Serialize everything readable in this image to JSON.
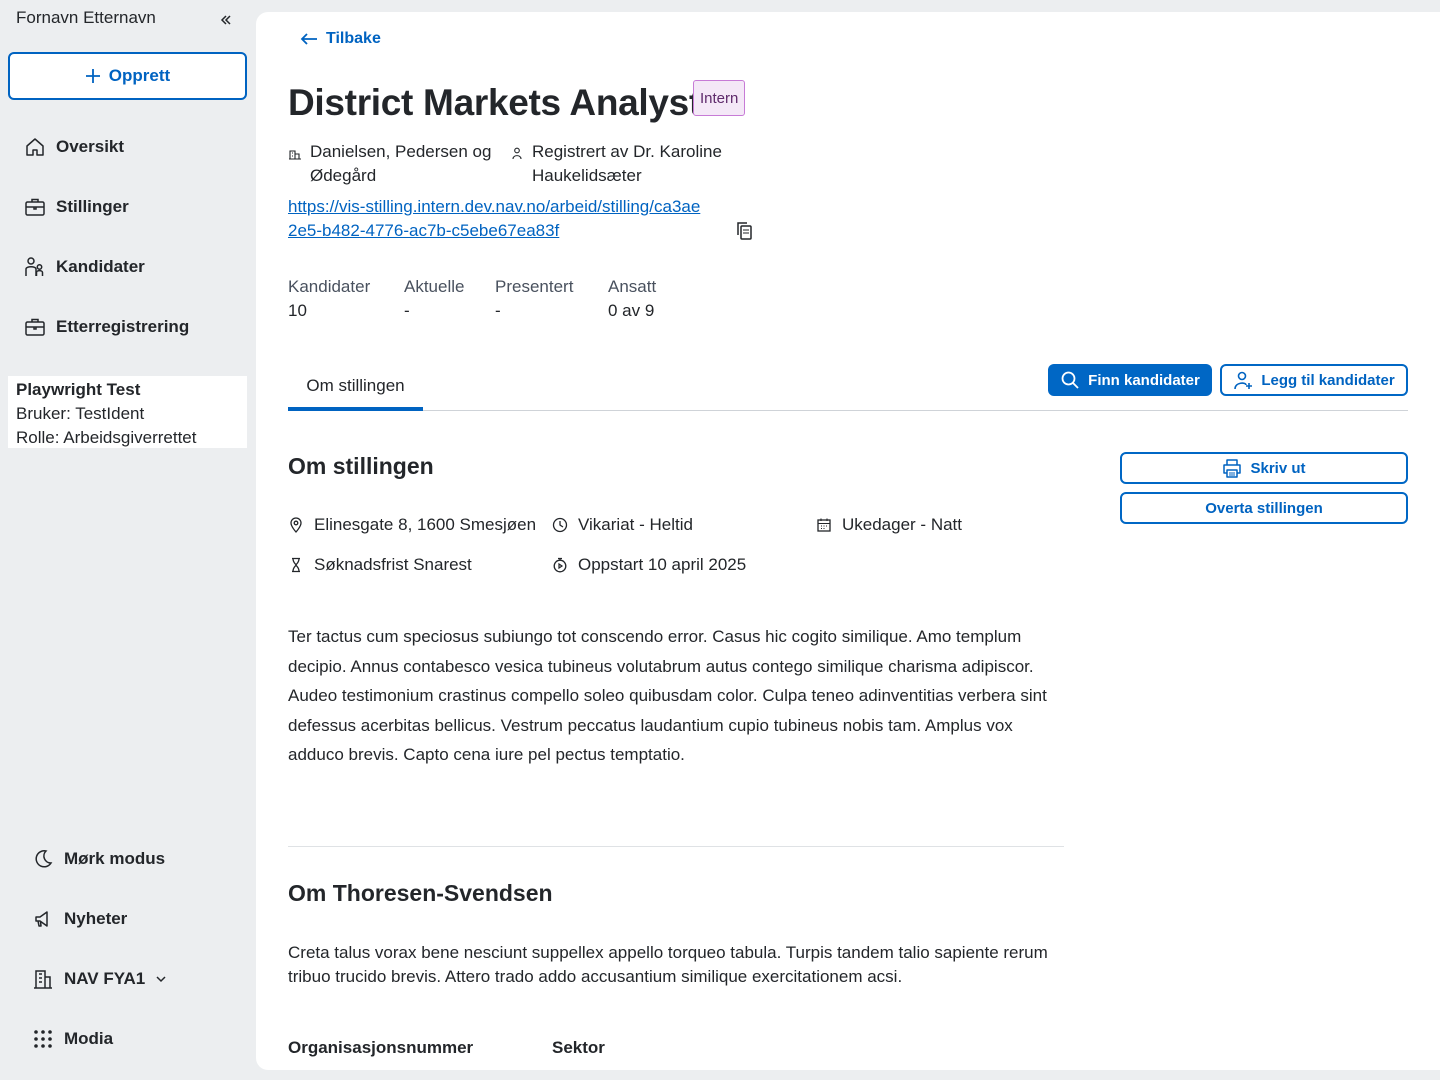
{
  "sidebar": {
    "user_name": "Fornavn Etternavn",
    "create_label": "Opprett",
    "nav": [
      {
        "label": "Oversikt",
        "icon": "house-icon"
      },
      {
        "label": "Stillinger",
        "icon": "briefcase-icon"
      },
      {
        "label": "Kandidater",
        "icon": "people-icon"
      },
      {
        "label": "Etterregistrering",
        "icon": "briefcase-icon"
      }
    ],
    "test_box": {
      "title": "Playwright Test",
      "user": "Bruker: TestIdent",
      "role": "Rolle: Arbeidsgiverrettet"
    },
    "bottom": {
      "dark_mode": "Mørk modus",
      "news": "Nyheter",
      "office": "NAV FYA1",
      "modia": "Modia"
    }
  },
  "main": {
    "back_label": "Tilbake",
    "title": "District Markets Analyst",
    "tag": "Intern",
    "employer": "Danielsen, Pedersen og Ødegård",
    "registered_by": "Registrert av Dr. Karoline Haukelidsæter",
    "url": "https://vis-stilling.intern.dev.nav.no/arbeid/stilling/ca3ae2e5-b482-4776-ac7b-c5ebe67ea83f",
    "stats": [
      {
        "label": "Kandidater",
        "value": "10"
      },
      {
        "label": "Aktuelle",
        "value": "-"
      },
      {
        "label": "Presentert",
        "value": "-"
      },
      {
        "label": "Ansatt",
        "value": "0 av 9"
      }
    ],
    "tab_label": "Om stillingen",
    "find_candidates": "Finn kandidater",
    "add_candidates": "Legg til kandidater",
    "print": "Skriv ut",
    "take_over": "Overta stillingen",
    "section1_title": "Om stillingen",
    "info": {
      "address": "Elinesgate 8, 1600 Smesjøen",
      "employment": "Vikariat - Heltid",
      "schedule": "Ukedager - Natt",
      "deadline": "Søknadsfrist Snarest",
      "start": "Oppstart 10 april 2025"
    },
    "description": "Ter tactus cum speciosus subiungo tot conscendo error. Casus hic cogito similique. Amo templum decipio. Annus contabesco vesica tubineus volutabrum autus contego similique charisma adipiscor. Audeo testimonium crastinus compello soleo quibusdam color. Culpa teneo adinventitias verbera sint defessus acerbitas bellicus. Vestrum peccatus laudantium cupio tubineus nobis tam. Amplus vox adduco brevis. Capto cena iure pel pectus temptatio.",
    "section2_title": "Om Thoresen-Svendsen",
    "employer_description": "Creta talus vorax bene nesciunt suppellex appello torqueo tabula. Turpis tandem talio sapiente rerum tribuo trucido brevis. Attero trado addo accusantium similique exercitationem acsi.",
    "org_number_label": "Organisasjonsnummer",
    "sector_label": "Sektor"
  }
}
